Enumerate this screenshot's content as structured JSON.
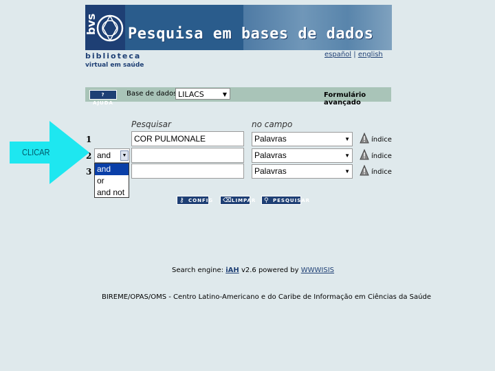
{
  "banner": {
    "title": "Pesquisa em bases de dados",
    "logo_text": "bvs",
    "caption_line1": "biblioteca",
    "caption_line2": "virtual em saúde"
  },
  "languages": {
    "espanol": "español",
    "separator": "|",
    "english": "english"
  },
  "toolbar": {
    "help_label": "? AJUDA",
    "db_label": "Base de dados :",
    "db_value": "LILACS",
    "form_label": "Formulário avançado"
  },
  "columns": {
    "search_header": "Pesquisar",
    "field_header": "no campo"
  },
  "rows": [
    {
      "num": "1",
      "operator": "",
      "query": "COR PULMONALE",
      "field": "Palavras",
      "index_label": "índice"
    },
    {
      "num": "2",
      "operator": "and",
      "query": "",
      "field": "Palavras",
      "index_label": "índice"
    },
    {
      "num": "3",
      "operator": "",
      "query": "",
      "field": "Palavras",
      "index_label": "índice"
    }
  ],
  "operator_options": [
    "and",
    "or",
    "and not"
  ],
  "buttons": {
    "config": "CONFIG",
    "limpar": "LIMPAR",
    "pesquisar": "PESQUISAR"
  },
  "annotation": {
    "clicar": "CLICAR"
  },
  "footer": {
    "engine_prefix": "Search engine:",
    "iah": "iAH",
    "engine_mid": "v2.6 powered by",
    "wwwisis": "WWWISIS",
    "institution": "BIREME/OPAS/OMS - Centro Latino-Americano e do Caribe de Informação em Ciências da Saúde"
  },
  "colors": {
    "brand": "#1e3f74",
    "accent_arrow": "#1ee7f0",
    "highlight": "#0a3fa8"
  }
}
